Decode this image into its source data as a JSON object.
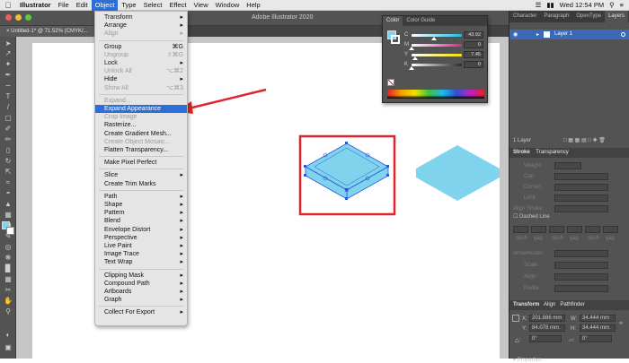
{
  "menubar": {
    "app_name": "Illustrator",
    "items": [
      "File",
      "Edit",
      "Object",
      "Type",
      "Select",
      "Effect",
      "View",
      "Window",
      "Help"
    ],
    "active_menu": "Object",
    "clock": "Wed 12:54 PM"
  },
  "window": {
    "title": "Adobe Illustrator 2020",
    "doc_tab": "Untitled-1* @ 71.52% (CMYK/...",
    "traffic_colors": [
      "#ee5f57",
      "#f6bd2f",
      "#5fc93f"
    ]
  },
  "object_menu": {
    "items": [
      {
        "label": "Transform",
        "sc": "▸",
        "state": "normal"
      },
      {
        "label": "Arrange",
        "sc": "▸",
        "state": "normal"
      },
      {
        "label": "Align",
        "sc": "▸",
        "state": "disabled"
      },
      {
        "sep": true
      },
      {
        "label": "Group",
        "sc": "⌘G",
        "state": "normal"
      },
      {
        "label": "Ungroup",
        "sc": "⇧⌘G",
        "state": "disabled"
      },
      {
        "label": "Lock",
        "sc": "▸",
        "state": "normal"
      },
      {
        "label": "Unlock All",
        "sc": "⌥⌘2",
        "state": "disabled"
      },
      {
        "label": "Hide",
        "sc": "▸",
        "state": "normal"
      },
      {
        "label": "Show All",
        "sc": "⌥⌘3",
        "state": "disabled"
      },
      {
        "sep": true
      },
      {
        "label": "Expand...",
        "sc": "",
        "state": "disabled"
      },
      {
        "label": "Expand Appearance",
        "sc": "",
        "state": "highlight"
      },
      {
        "label": "Crop Image",
        "sc": "",
        "state": "disabled"
      },
      {
        "label": "Rasterize...",
        "sc": "",
        "state": "normal"
      },
      {
        "label": "Create Gradient Mesh...",
        "sc": "",
        "state": "normal"
      },
      {
        "label": "Create Object Mosaic...",
        "sc": "",
        "state": "disabled"
      },
      {
        "label": "Flatten Transparency...",
        "sc": "",
        "state": "normal"
      },
      {
        "sep": true
      },
      {
        "label": "Make Pixel Perfect",
        "sc": "",
        "state": "normal"
      },
      {
        "sep": true
      },
      {
        "label": "Slice",
        "sc": "▸",
        "state": "normal"
      },
      {
        "label": "Create Trim Marks",
        "sc": "",
        "state": "normal"
      },
      {
        "sep": true
      },
      {
        "label": "Path",
        "sc": "▸",
        "state": "normal"
      },
      {
        "label": "Shape",
        "sc": "▸",
        "state": "normal"
      },
      {
        "label": "Pattern",
        "sc": "▸",
        "state": "normal"
      },
      {
        "label": "Blend",
        "sc": "▸",
        "state": "normal"
      },
      {
        "label": "Envelope Distort",
        "sc": "▸",
        "state": "normal"
      },
      {
        "label": "Perspective",
        "sc": "▸",
        "state": "normal"
      },
      {
        "label": "Live Paint",
        "sc": "▸",
        "state": "normal"
      },
      {
        "label": "Image Trace",
        "sc": "▸",
        "state": "normal"
      },
      {
        "label": "Text Wrap",
        "sc": "▸",
        "state": "normal"
      },
      {
        "sep": true
      },
      {
        "label": "Clipping Mask",
        "sc": "▸",
        "state": "normal"
      },
      {
        "label": "Compound Path",
        "sc": "▸",
        "state": "normal"
      },
      {
        "label": "Artboards",
        "sc": "▸",
        "state": "normal"
      },
      {
        "label": "Graph",
        "sc": "▸",
        "state": "normal"
      },
      {
        "sep": true
      },
      {
        "label": "Collect For Export",
        "sc": "▸",
        "state": "normal"
      }
    ]
  },
  "color_panel": {
    "tabs": [
      "Color",
      "Color Guide"
    ],
    "channels": [
      {
        "label": "C",
        "value": "43.92",
        "color": "#20b8e6",
        "pos": 0.44
      },
      {
        "label": "M",
        "value": "0",
        "color": "#e0208a",
        "pos": 0.0
      },
      {
        "label": "Y",
        "value": "7.45",
        "color": "#f2e100",
        "pos": 0.07
      },
      {
        "label": "K",
        "value": "0",
        "color": "#2a2a2a",
        "pos": 0.0
      }
    ],
    "fill_color": "#7fd3ec"
  },
  "right_dock": {
    "tabs": [
      "Character",
      "Paragraph",
      "OpenType",
      "Layers"
    ],
    "layer_name": "Layer 1",
    "layer_count": "1 Layer",
    "stroke_tabs": [
      "Stroke",
      "Transparency"
    ],
    "stroke_fields": [
      "Weight:",
      "Cap:",
      "Corner:",
      "Limit:",
      "Align Stroke:"
    ],
    "dashed_label": "Dashed Line",
    "dash_cells": [
      "dash",
      "gap",
      "dash",
      "gap",
      "dash",
      "gap"
    ],
    "stroke_fields_2": [
      "Arrowheads:",
      "Scale:",
      "Align:",
      "Profile:"
    ],
    "transform_tabs": [
      "Transform",
      "Align",
      "Pathfinder"
    ],
    "transform": {
      "x": "201.886 mm",
      "y": "84.078 mm",
      "w": "34.444 mm",
      "h": "34.444 mm",
      "angle": "0°",
      "shear": "0°"
    },
    "properties_label": "Properties"
  },
  "canvas": {
    "shape_color": "#7fd3ec",
    "selection_color": "#2b58d9",
    "highlight_box_color": "#e0242a",
    "arrow_color": "#e0242a"
  }
}
